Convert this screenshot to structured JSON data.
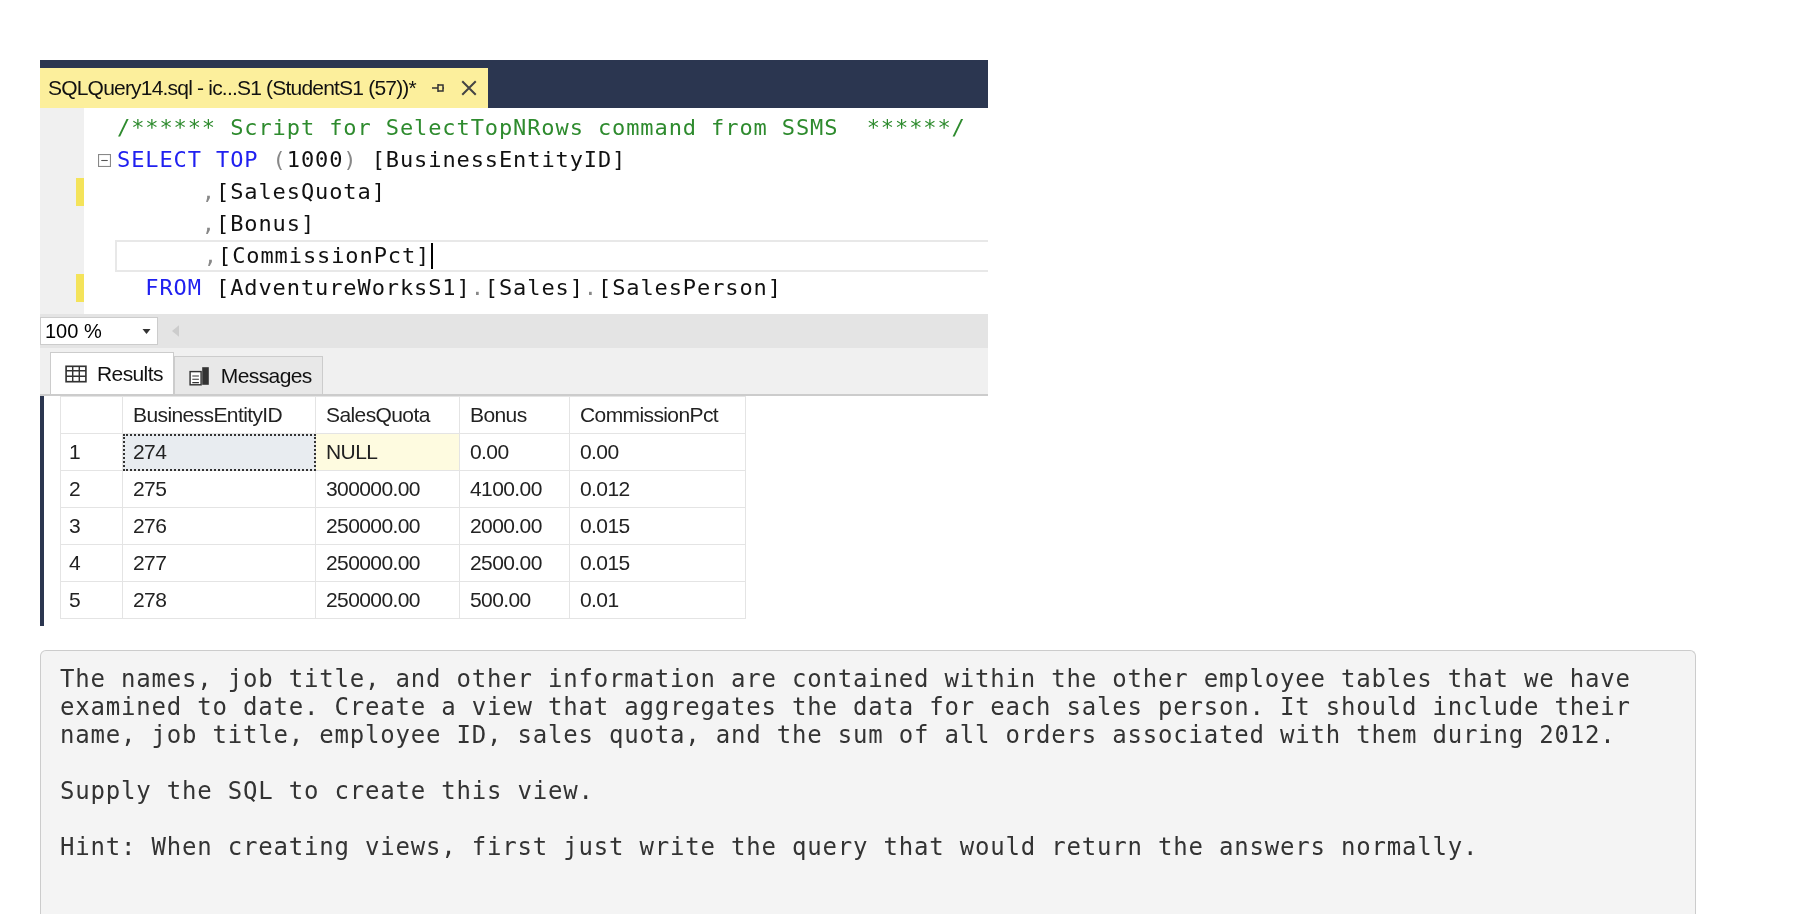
{
  "editor_window": {
    "document_tab": {
      "title": "SQLQuery14.sql - ic...S1 (StudentS1 (57))*"
    },
    "code_lines": [
      {
        "changed": false,
        "current": false,
        "foldable": false,
        "tokens": [
          {
            "text": "/****** Script for SelectTopNRows command from SSMS  ******/",
            "kind": "comment"
          }
        ]
      },
      {
        "changed": false,
        "current": false,
        "foldable": true,
        "tokens": [
          {
            "text": "SELECT TOP ",
            "kind": "keyword"
          },
          {
            "text": "(",
            "kind": "punct"
          },
          {
            "text": "1000",
            "kind": "plain"
          },
          {
            "text": ") ",
            "kind": "punct"
          },
          {
            "text": "[BusinessEntityID]",
            "kind": "plain"
          }
        ]
      },
      {
        "changed": true,
        "current": false,
        "foldable": false,
        "tokens": [
          {
            "text": "      ,",
            "kind": "punct"
          },
          {
            "text": "[SalesQuota]",
            "kind": "plain"
          }
        ]
      },
      {
        "changed": false,
        "current": false,
        "foldable": false,
        "tokens": [
          {
            "text": "      ,",
            "kind": "punct"
          },
          {
            "text": "[Bonus]",
            "kind": "plain"
          }
        ]
      },
      {
        "changed": false,
        "current": true,
        "foldable": false,
        "tokens": [
          {
            "text": "      ,",
            "kind": "punct"
          },
          {
            "text": "[CommissionPct]",
            "kind": "plain"
          }
        ]
      },
      {
        "changed": true,
        "current": false,
        "foldable": false,
        "tokens": [
          {
            "text": "  FROM ",
            "kind": "keyword"
          },
          {
            "text": "[AdventureWorksS1]",
            "kind": "plain"
          },
          {
            "text": ".",
            "kind": "punct"
          },
          {
            "text": "[Sales]",
            "kind": "plain"
          },
          {
            "text": ".",
            "kind": "punct"
          },
          {
            "text": "[SalesPerson]",
            "kind": "plain"
          }
        ]
      }
    ],
    "zoom": {
      "value": "100 %"
    },
    "result_tabs": [
      {
        "label": "Results",
        "selected": true
      },
      {
        "label": "Messages",
        "selected": false
      }
    ],
    "grid": {
      "columns": [
        "BusinessEntityID",
        "SalesQuota",
        "Bonus",
        "CommissionPct"
      ],
      "rows": [
        {
          "number": "1",
          "cells": [
            {
              "text": "274",
              "kind": "value",
              "selected": true
            },
            {
              "text": "NULL",
              "kind": "null",
              "selected": false
            },
            {
              "text": "0.00",
              "kind": "value",
              "selected": false
            },
            {
              "text": "0.00",
              "kind": "value",
              "selected": false
            }
          ]
        },
        {
          "number": "2",
          "cells": [
            {
              "text": "275",
              "kind": "value",
              "selected": false
            },
            {
              "text": "300000.00",
              "kind": "value",
              "selected": false
            },
            {
              "text": "4100.00",
              "kind": "value",
              "selected": false
            },
            {
              "text": "0.012",
              "kind": "value",
              "selected": false
            }
          ]
        },
        {
          "number": "3",
          "cells": [
            {
              "text": "276",
              "kind": "value",
              "selected": false
            },
            {
              "text": "250000.00",
              "kind": "value",
              "selected": false
            },
            {
              "text": "2000.00",
              "kind": "value",
              "selected": false
            },
            {
              "text": "0.015",
              "kind": "value",
              "selected": false
            }
          ]
        },
        {
          "number": "4",
          "cells": [
            {
              "text": "277",
              "kind": "value",
              "selected": false
            },
            {
              "text": "250000.00",
              "kind": "value",
              "selected": false
            },
            {
              "text": "2500.00",
              "kind": "value",
              "selected": false
            },
            {
              "text": "0.015",
              "kind": "value",
              "selected": false
            }
          ]
        },
        {
          "number": "5",
          "cells": [
            {
              "text": "278",
              "kind": "value",
              "selected": false
            },
            {
              "text": "250000.00",
              "kind": "value",
              "selected": false
            },
            {
              "text": "500.00",
              "kind": "value",
              "selected": false
            },
            {
              "text": "0.01",
              "kind": "value",
              "selected": false
            }
          ]
        }
      ]
    }
  },
  "question": {
    "paragraphs": [
      "The names, job title, and other information are contained within the other employee tables that we have\nexamined to date. Create a view that aggregates the data for each sales person. It should include their\nname, job title, employee ID, sales quota, and the sum of all orders associated with them during 2012.",
      "Supply the SQL to create this view.",
      "Hint: When creating views, first just write the query that would return the answers normally."
    ]
  }
}
